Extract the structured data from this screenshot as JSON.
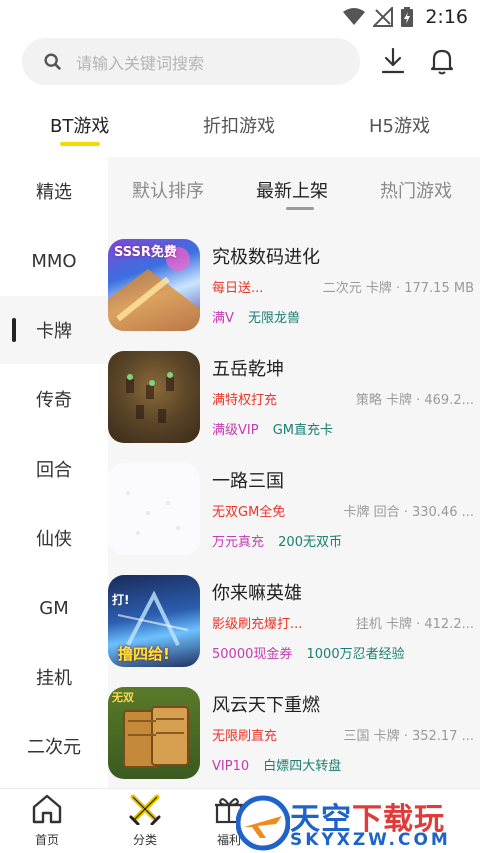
{
  "status": {
    "time": "2:16"
  },
  "search": {
    "placeholder": "请输入关键词搜索"
  },
  "top_tabs": [
    "BT游戏",
    "折扣游戏",
    "H5游戏"
  ],
  "top_tab_active": 0,
  "categories": [
    "精选",
    "MMO",
    "卡牌",
    "传奇",
    "回合",
    "仙侠",
    "GM",
    "挂机",
    "二次元"
  ],
  "category_active": 2,
  "sort_tabs": [
    "默认排序",
    "最新上架",
    "热门游戏"
  ],
  "sort_tab_active": 1,
  "games": [
    {
      "name": "究极数码进化",
      "promo": "每日送...",
      "info": "二次元 卡牌 · 177.15 MB",
      "tags": [
        "满V",
        "无限龙兽"
      ]
    },
    {
      "name": "五岳乾坤",
      "promo": "满特权打充",
      "info": "策略 卡牌 · 469.2...",
      "tags": [
        "满级VIP",
        "GM直充卡"
      ]
    },
    {
      "name": "一路三国",
      "promo": "无双GM全免",
      "info": "卡牌 回合 · 330.46 ...",
      "tags": [
        "万元真充",
        "200无双币"
      ]
    },
    {
      "name": "你来嘛英雄",
      "promo": "影级刷充爆打...",
      "info": "挂机 卡牌 · 412.2...",
      "tags": [
        "50000现金券",
        "1000万忍者经验"
      ]
    },
    {
      "name": "风云天下重燃",
      "promo": "无限刷直充",
      "info": "三国 卡牌 · 352.17 ...",
      "tags": [
        "VIP10",
        "白嫖四大转盘"
      ]
    }
  ],
  "thumb_text": {
    "game1": "SSSR免费",
    "game4_top": "打!",
    "game4_bottom": "撸四给!",
    "game5": "无双"
  },
  "bottom_nav": [
    "首页",
    "分类",
    "福利"
  ],
  "watermark": {
    "title_blue": "天空",
    "title_red": "下载玩",
    "domain": "SKYXZW.COM"
  },
  "colors": {
    "accent_yellow": "#f5d800",
    "promo_red": "#e8352a",
    "tag_pink": "#c43bb2",
    "tag_teal": "#1a7f6f",
    "watermark_blue": "#1e63c8"
  },
  "icons": {
    "search": "search-icon",
    "download": "download-icon",
    "notification": "bell-icon",
    "home": "home-icon",
    "category": "crossed-swords-icon",
    "welfare": "gift-icon"
  }
}
